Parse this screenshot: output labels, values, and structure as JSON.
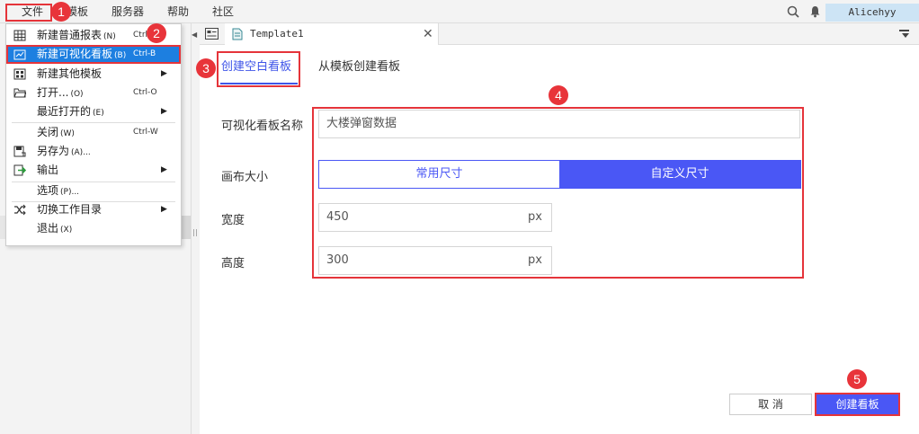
{
  "menubar": {
    "items": [
      "文件",
      "模板",
      "服务器",
      "帮助",
      "社区"
    ],
    "user": "Alicehyy"
  },
  "file_menu": {
    "items": [
      {
        "label": "新建普通报表",
        "key": "(N)",
        "shortcut": "Ctrl-N"
      },
      {
        "label": "新建可视化看板",
        "key": "(B)",
        "shortcut": "Ctrl-B"
      },
      {
        "label": "新建其他模板",
        "key": "",
        "shortcut": ""
      },
      {
        "label": "打开...",
        "key": "(O)",
        "shortcut": "Ctrl-O"
      },
      {
        "label": "最近打开的",
        "key": "(E)",
        "shortcut": ""
      },
      {
        "label": "关闭",
        "key": "(W)",
        "shortcut": "Ctrl-W"
      },
      {
        "label": "另存为",
        "key": "(A)...",
        "shortcut": ""
      },
      {
        "label": "输出",
        "key": "",
        "shortcut": ""
      },
      {
        "label": "选项",
        "key": "(P)...",
        "shortcut": ""
      },
      {
        "label": "切换工作目录",
        "key": "",
        "shortcut": ""
      },
      {
        "label": "退出",
        "key": "(X)",
        "shortcut": ""
      }
    ]
  },
  "doc_tab": {
    "name": "Template1"
  },
  "dialog": {
    "tabs": [
      "创建空白看板",
      "从模板创建看板"
    ],
    "name_label": "可视化看板名称",
    "name_value": "大楼弹窗数据",
    "canvas_label": "画布大小",
    "canvas_options": [
      "常用尺寸",
      "自定义尺寸"
    ],
    "width_label": "宽度",
    "width_value": "450",
    "height_label": "高度",
    "height_value": "300",
    "unit": "px",
    "cancel": "取 消",
    "create": "创建看板"
  },
  "badges": [
    "1",
    "2",
    "3",
    "4",
    "5"
  ],
  "colors": {
    "accent": "#4a57f5",
    "highlight": "#1d7fe0",
    "annotation": "#e5343a"
  }
}
